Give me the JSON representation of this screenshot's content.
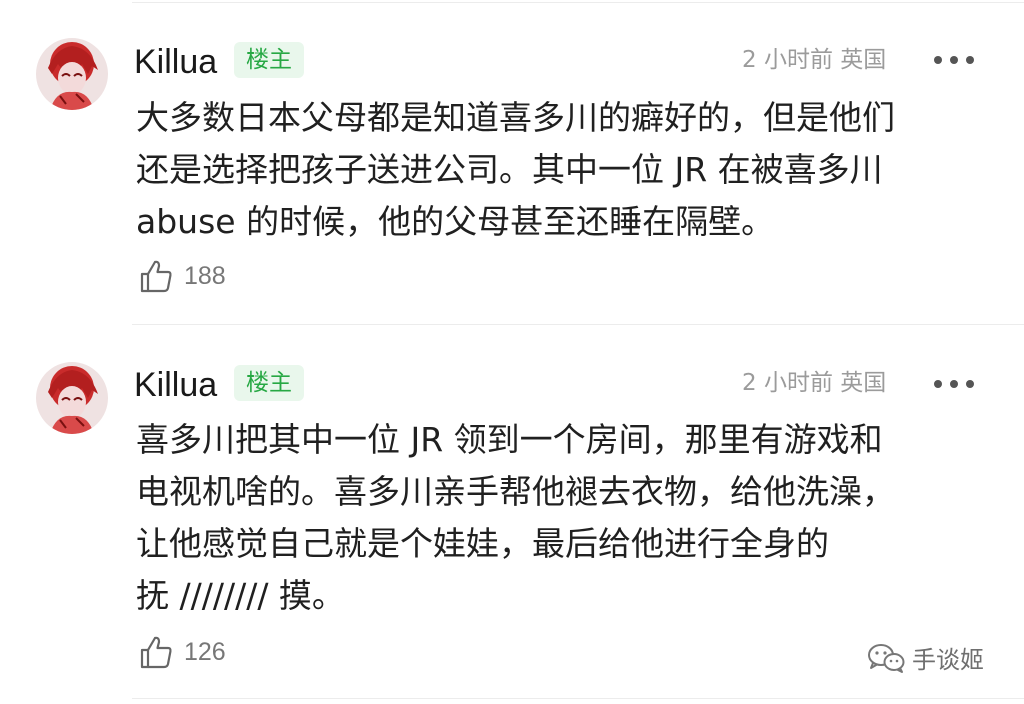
{
  "comments": [
    {
      "username": "Killua",
      "badge": "楼主",
      "meta": "2 小时前 英国",
      "body": "大多数日本父母都是知道喜多川的癖好的，但是他们\n还是选择把孩子送进公司。其中一位 JR 在被喜多川\nabuse 的时候，他的父母甚至还睡在隔壁。",
      "likes": "188"
    },
    {
      "username": "Killua",
      "badge": "楼主",
      "meta": "2 小时前 英国",
      "body": "喜多川把其中一位 JR 领到一个房间，那里有游戏和\n电视机啥的。喜多川亲手帮他褪去衣物，给他洗澡，\n让他感觉自己就是个娃娃，最后给他进行全身的\n抚 //////// 摸。",
      "likes": "126"
    }
  ],
  "watermark": {
    "text": "手谈姬"
  },
  "icons": {
    "like": "thumbs-up-icon",
    "more": "more-dots-icon",
    "watermark": "wechat-icon"
  },
  "colors": {
    "badge_bg": "#e9f7ec",
    "badge_text": "#27a844",
    "meta_text": "#9b9b9b"
  }
}
